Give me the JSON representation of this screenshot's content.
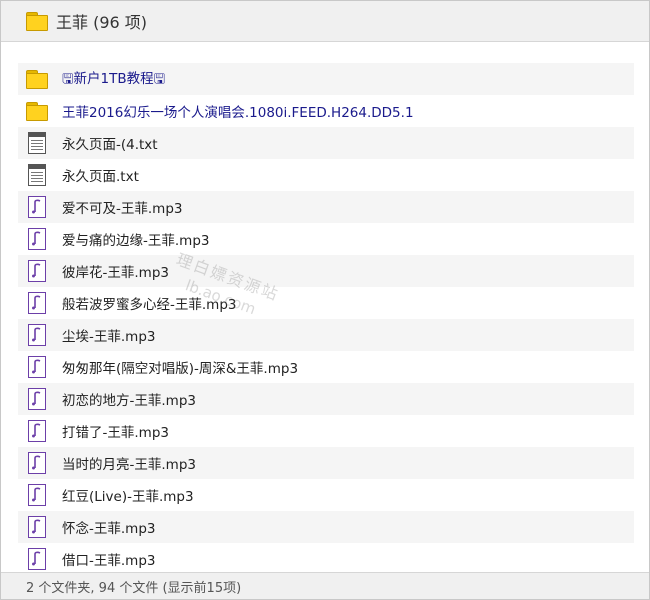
{
  "header": {
    "title": "王菲 (96 项)"
  },
  "items": [
    {
      "type": "folder",
      "name": "🖫新户1TB教程🖫"
    },
    {
      "type": "folder",
      "name": "王菲2016幻乐一场个人演唱会.1080i.FEED.H264.DD5.1"
    },
    {
      "type": "txt",
      "name": "永久页面-(4.txt"
    },
    {
      "type": "txt",
      "name": "永久页面.txt"
    },
    {
      "type": "mp3",
      "name": "爱不可及-王菲.mp3"
    },
    {
      "type": "mp3",
      "name": "爱与痛的边缘-王菲.mp3"
    },
    {
      "type": "mp3",
      "name": "彼岸花-王菲.mp3"
    },
    {
      "type": "mp3",
      "name": "般若波罗蜜多心经-王菲.mp3"
    },
    {
      "type": "mp3",
      "name": "尘埃-王菲.mp3"
    },
    {
      "type": "mp3",
      "name": "匆匆那年(隔空对唱版)-周深&王菲.mp3"
    },
    {
      "type": "mp3",
      "name": "初恋的地方-王菲.mp3"
    },
    {
      "type": "mp3",
      "name": "打错了-王菲.mp3"
    },
    {
      "type": "mp3",
      "name": "当时的月亮-王菲.mp3"
    },
    {
      "type": "mp3",
      "name": "红豆(Live)-王菲.mp3"
    },
    {
      "type": "mp3",
      "name": "怀念-王菲.mp3"
    },
    {
      "type": "mp3",
      "name": "借口-王菲.mp3"
    }
  ],
  "footer": {
    "summary": "2 个文件夹, 94 个文件 (显示前15项)"
  },
  "watermark": {
    "line1": "理白嫖资源站",
    "line2": "lb.ao.com"
  },
  "colors": {
    "folder_text": "#1a1a8c",
    "file_text": "#222222",
    "row_shade": "#f5f5f5",
    "header_bg": "#f0f0f0",
    "folder_fill": "#ffd21f",
    "audio_note": "#6c3fa8"
  },
  "icons": {
    "folder": "folder-icon",
    "txt": "text-file-icon",
    "mp3": "audio-file-icon"
  }
}
